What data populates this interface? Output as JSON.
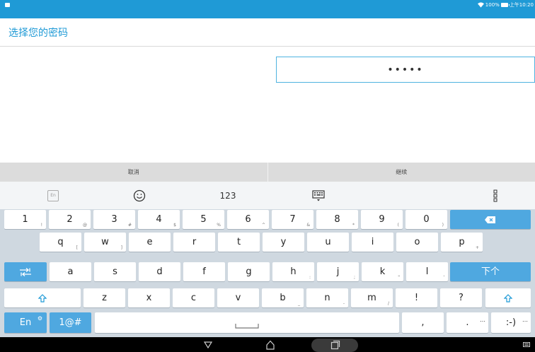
{
  "status_bar": {
    "battery_text": "100%",
    "time": "上午10:20"
  },
  "page": {
    "title": "选择您的密码",
    "password_masked": "•••••"
  },
  "actions": {
    "cancel": "取消",
    "continue": "继续"
  },
  "keyboard": {
    "toolbar": {
      "lang_badge": "En",
      "num_label": "123",
      "icons": [
        "emoji-icon",
        "keyboard-settings-icon",
        "more-vertical-icon"
      ]
    },
    "row1": [
      {
        "k": "1",
        "s": "!"
      },
      {
        "k": "2",
        "s": "@"
      },
      {
        "k": "3",
        "s": "#"
      },
      {
        "k": "4",
        "s": "$"
      },
      {
        "k": "5",
        "s": "%"
      },
      {
        "k": "6",
        "s": "^"
      },
      {
        "k": "7",
        "s": "&"
      },
      {
        "k": "8",
        "s": "*"
      },
      {
        "k": "9",
        "s": "("
      },
      {
        "k": "0",
        "s": ")"
      }
    ],
    "row2": [
      {
        "k": "q",
        "s": "["
      },
      {
        "k": "w",
        "s": "]"
      },
      {
        "k": "e",
        "s": ""
      },
      {
        "k": "r",
        "s": ""
      },
      {
        "k": "t",
        "s": ""
      },
      {
        "k": "y",
        "s": ""
      },
      {
        "k": "u",
        "s": ""
      },
      {
        "k": "i",
        "s": ""
      },
      {
        "k": "o",
        "s": ""
      },
      {
        "k": "p",
        "s": "+"
      }
    ],
    "row3": [
      {
        "k": "a",
        "s": ""
      },
      {
        "k": "s",
        "s": ""
      },
      {
        "k": "d",
        "s": ""
      },
      {
        "k": "f",
        "s": ""
      },
      {
        "k": "g",
        "s": ""
      },
      {
        "k": "h",
        "s": ":"
      },
      {
        "k": "j",
        "s": ";"
      },
      {
        "k": "k",
        "s": "\""
      },
      {
        "k": "l",
        "s": "'"
      }
    ],
    "row3_next": "下个",
    "row4": [
      {
        "k": "z",
        "s": ""
      },
      {
        "k": "x",
        "s": ""
      },
      {
        "k": "c",
        "s": ""
      },
      {
        "k": "v",
        "s": ""
      },
      {
        "k": "b",
        "s": "_"
      },
      {
        "k": "n",
        "s": "-"
      },
      {
        "k": "m",
        "s": "/"
      },
      {
        "k": "!",
        "s": ""
      },
      {
        "k": "?",
        "s": ""
      }
    ],
    "row5": {
      "lang": "En",
      "symbols": "1@#",
      "comma": ",",
      "period": ".",
      "emoticon": ":-)"
    }
  },
  "colors": {
    "accent": "#1f9ad6",
    "key_blue": "#4fa8e0",
    "keyboard_bg": "#cfd8e0"
  }
}
